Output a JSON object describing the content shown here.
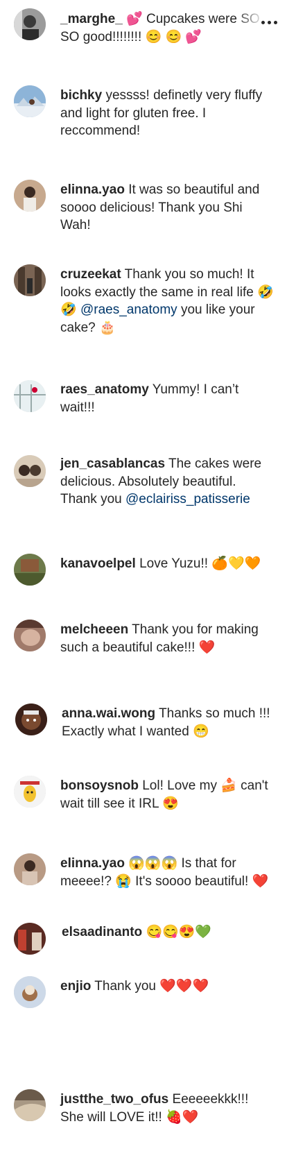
{
  "comments": [
    {
      "username": "_marghe_",
      "text": "💕 Cupcakes were SO SO good!!!!!!!! 😊 😊 💕",
      "avatar_color": "#8c8c8c"
    },
    {
      "username": "bichky",
      "text": "yessss! definetly very fluffy and light for gluten free. I reccommend!",
      "avatar_color": "#7fa7c9"
    },
    {
      "username": "elinna.yao",
      "text": "It was so beautiful and soooo delicious! Thank you Shi Wah!",
      "avatar_color": "#b08a70"
    },
    {
      "username": "cruzeekat",
      "text": "Thank you so much! It looks exactly the same in real life 🤣🤣",
      "mention": "@raes_anatomy",
      "text_after": "you like your cake? 🎂",
      "avatar_color": "#6b5444"
    },
    {
      "username": "raes_anatomy",
      "text": "Yummy! I can’t wait!!!",
      "avatar_color": "#d9e6e9"
    },
    {
      "username": "jen_casablancas",
      "text": "The cakes were delicious. Absolutely beautiful. Thank you",
      "mention": "@eclairiss_patisserie",
      "avatar_color": "#c8b8a4"
    },
    {
      "username": "kanavoelpel",
      "text": "Love Yuzu!! 🍊💛🧡",
      "avatar_color": "#5d6b3f"
    },
    {
      "username": "melcheeen",
      "text": "Thank you for making such a beautiful cake!!! ❤️",
      "avatar_color": "#8a6a60"
    },
    {
      "username": "anna.wai.wong",
      "text": "Thanks so much !!! Exactly what I wanted 😁",
      "avatar_color": "#4a2a22"
    },
    {
      "username": "bonsoysnob",
      "text": "Lol! Love my 🍰 can't wait till see it IRL 😍",
      "avatar_color": "#f2f2f2"
    },
    {
      "username": "elinna.yao",
      "text": "😱😱😱 Is that for meeee!? 😭 It's soooo beautiful! ❤️",
      "avatar_color": "#a48a76"
    },
    {
      "username": "elsaadinanto",
      "text": "😋😋😍💚",
      "avatar_color": "#6e2a24"
    },
    {
      "username": "enjio",
      "text": "Thank you ❤️❤️❤️",
      "avatar_color": "#c4d4e6"
    },
    {
      "username": "justthe_two_ofus",
      "text": "Eeeeeekkk!!! She will LOVE it!! 🍓❤️",
      "avatar_color": "#9c8c78"
    }
  ],
  "more_options_icon": "more-horizontal-icon"
}
